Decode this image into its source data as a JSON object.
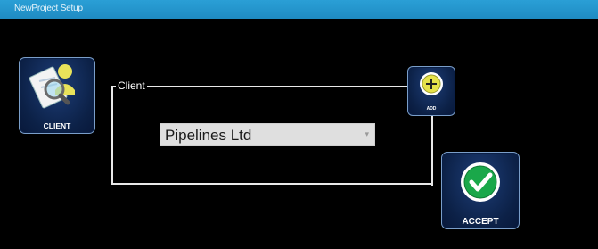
{
  "window": {
    "title": "NewProject Setup"
  },
  "client_button": {
    "label": "CLIENT",
    "icon": "client-search-icon"
  },
  "client_group": {
    "legend": "Client",
    "selected_client": "Pipelines Ltd",
    "dropdown_icon": "chevron-down-icon"
  },
  "add_button": {
    "label": "ADD",
    "icon": "add-plus-icon"
  },
  "accept_button": {
    "label": "ACCEPT",
    "icon": "checkmark-icon"
  },
  "colors": {
    "titlebar": "#2a9fd6",
    "background": "#000000",
    "tile": "#0c2147",
    "accent_yellow": "#e6e24a",
    "accent_green": "#1aa84a"
  }
}
